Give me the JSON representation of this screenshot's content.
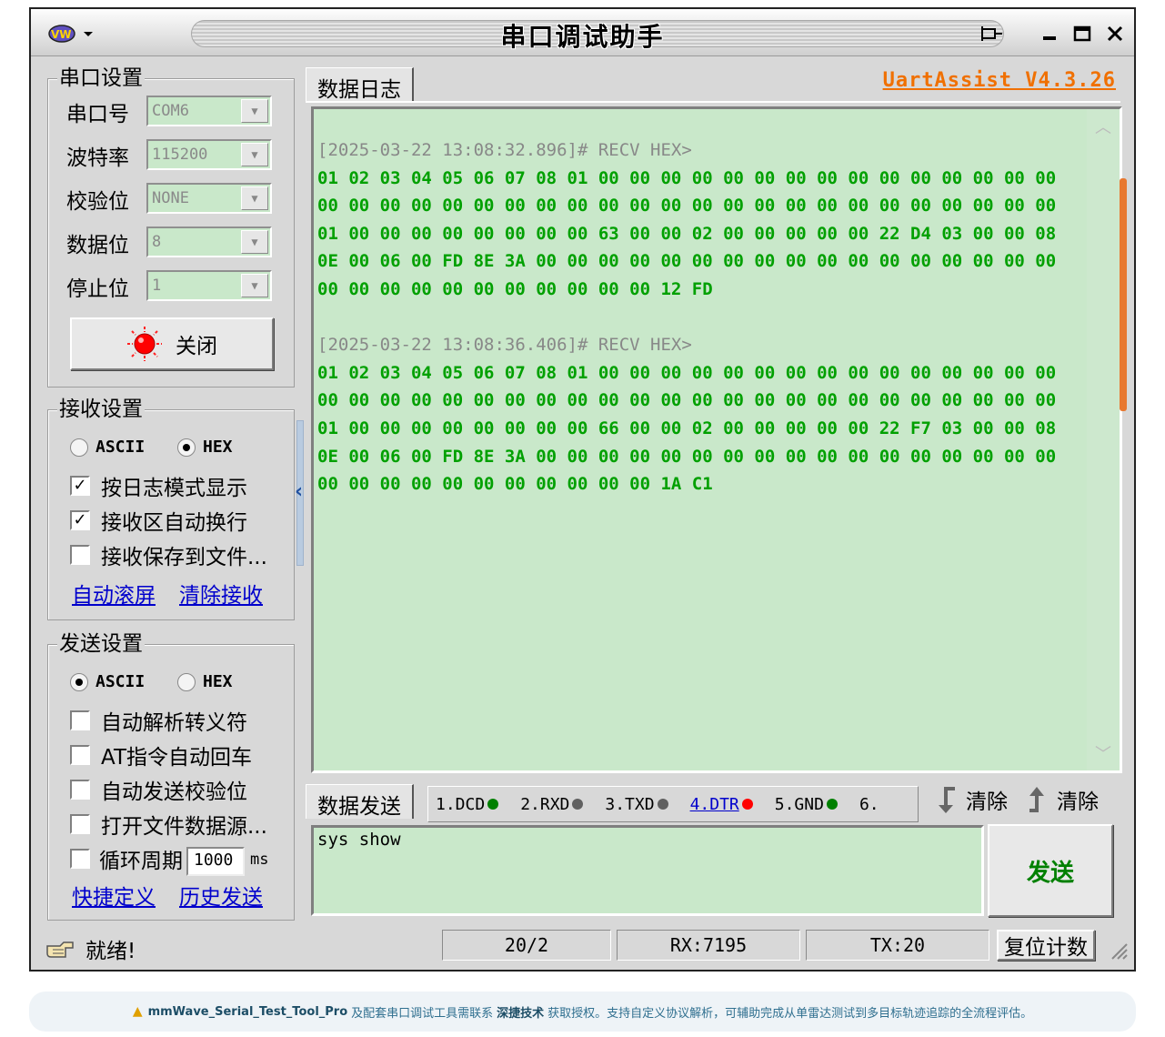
{
  "window": {
    "title": "串口调试助手",
    "controls": [
      "pin-icon",
      "minimize-icon",
      "maximize-icon",
      "close-icon"
    ]
  },
  "serial_settings": {
    "title": "串口设置",
    "port": {
      "label": "串口号",
      "value": "COM6"
    },
    "baud": {
      "label": "波特率",
      "value": "115200"
    },
    "parity": {
      "label": "校验位",
      "value": "NONE"
    },
    "databits": {
      "label": "数据位",
      "value": "8"
    },
    "stopbits": {
      "label": "停止位",
      "value": "1"
    },
    "close_button": "关闭",
    "status_color": "#ff0000"
  },
  "receive_settings": {
    "title": "接收设置",
    "ascii_label": "ASCII",
    "hex_label": "HEX",
    "selected": "HEX",
    "log_mode": {
      "label": "按日志模式显示",
      "checked": true
    },
    "auto_wrap": {
      "label": "接收区自动换行",
      "checked": true
    },
    "save_file": {
      "label": "接收保存到文件...",
      "checked": false
    },
    "auto_scroll_link": "自动滚屏",
    "clear_link": "清除接收"
  },
  "send_settings": {
    "title": "发送设置",
    "ascii_label": "ASCII",
    "hex_label": "HEX",
    "selected": "ASCII",
    "escape": {
      "label": "自动解析转义符",
      "checked": false
    },
    "at_cr": {
      "label": "AT指令自动回车",
      "checked": false
    },
    "checksum": {
      "label": "自动发送校验位",
      "checked": false
    },
    "file_source": {
      "label": "打开文件数据源...",
      "checked": false
    },
    "cycle": {
      "label": "循环周期",
      "checked": false,
      "value": "1000",
      "unit": "ms"
    },
    "shortcut_link": "快捷定义",
    "history_link": "历史发送"
  },
  "log_tab": {
    "label": "数据日志"
  },
  "brand": "UartAssist V4.3.26",
  "log": [
    {
      "timestamp": "[2025-03-22 13:08:32.896]# RECV HEX>",
      "lines": [
        "01 02 03 04 05 06 07 08 01 00 00 00 00 00 00 00 00 00 00 00 00 00 00 00",
        "00 00 00 00 00 00 00 00 00 00 00 00 00 00 00 00 00 00 00 00 00 00 00 00",
        "01 00 00 00 00 00 00 00 00 63 00 00 02 00 00 00 00 00 22 D4 03 00 00 08",
        "0E 00 06 00 FD 8E 3A 00 00 00 00 00 00 00 00 00 00 00 00 00 00 00 00 00",
        "00 00 00 00 00 00 00 00 00 00 00 12 FD"
      ]
    },
    {
      "timestamp": "[2025-03-22 13:08:36.406]# RECV HEX>",
      "lines": [
        "01 02 03 04 05 06 07 08 01 00 00 00 00 00 00 00 00 00 00 00 00 00 00 00",
        "00 00 00 00 00 00 00 00 00 00 00 00 00 00 00 00 00 00 00 00 00 00 00 00",
        "01 00 00 00 00 00 00 00 00 66 00 00 02 00 00 00 00 00 22 F7 03 00 00 08",
        "0E 00 06 00 FD 8E 3A 00 00 00 00 00 00 00 00 00 00 00 00 00 00 00 00 00",
        "00 00 00 00 00 00 00 00 00 00 00 1A C1"
      ]
    }
  ],
  "send_tab": {
    "label": "数据发送"
  },
  "pins": [
    {
      "label": "1.DCD",
      "color": "#008000",
      "link": false
    },
    {
      "label": "2.RXD",
      "color": "#606060",
      "link": false
    },
    {
      "label": "3.TXD",
      "color": "#606060",
      "link": false
    },
    {
      "label": "4.DTR",
      "color": "#ff0000",
      "link": true
    },
    {
      "label": "5.GND",
      "color": "#008000",
      "link": false
    },
    {
      "label": "6.",
      "color": "",
      "link": false
    }
  ],
  "clear_send": "清除",
  "clear_recv": "清除",
  "send_input": "sys show",
  "send_button": "发送",
  "status": {
    "ready": "就绪!",
    "count": "20/2",
    "rx": "RX:7195",
    "tx": "TX:20",
    "reset": "复位计数"
  },
  "notice": {
    "product": "mmWave_Serial_Test_Tool_Pro",
    "text1": "及配套串口调试工具需联系",
    "company": "深捷技术",
    "text2": "获取授权。支持自定义协议解析，可辅助完成从单雷达测试到多目标轨迹追踪的全流程评估。"
  }
}
